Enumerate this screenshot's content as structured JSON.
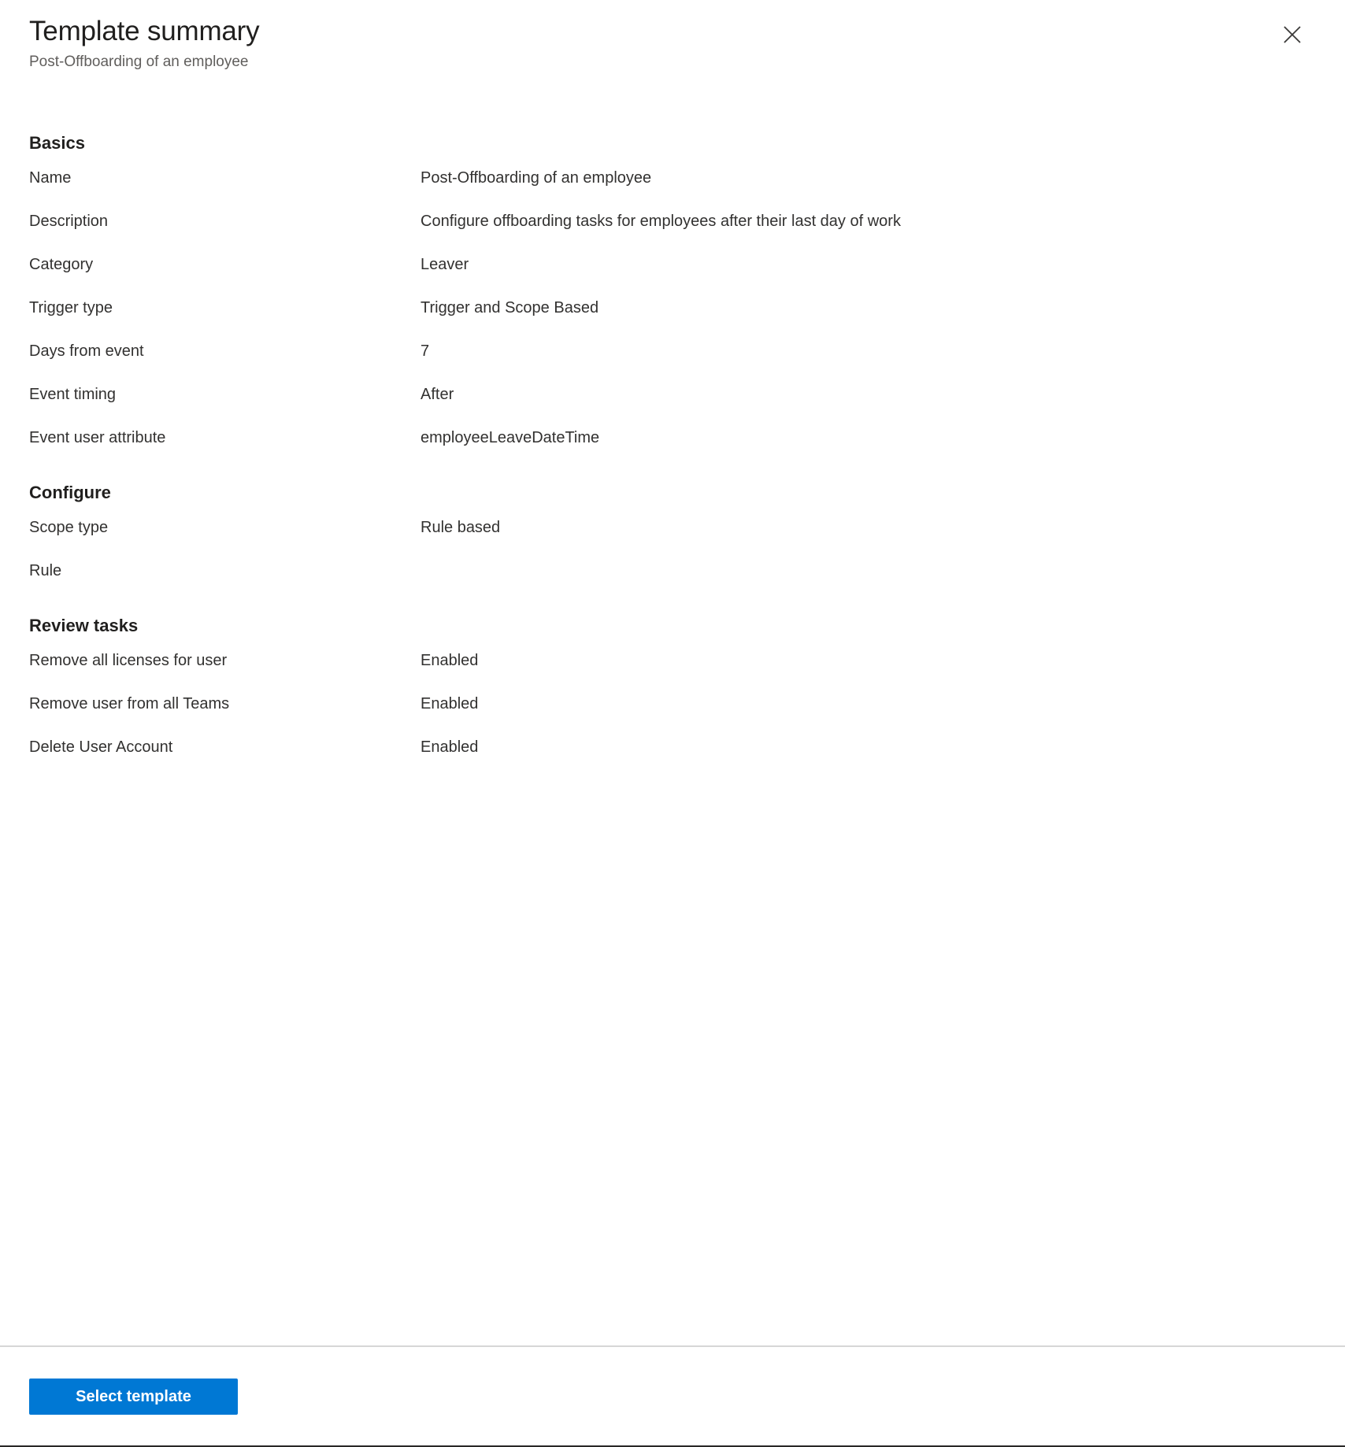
{
  "header": {
    "title": "Template summary",
    "subtitle": "Post-Offboarding of an employee",
    "close_icon": "close-icon",
    "close_label": "Close"
  },
  "sections": [
    {
      "id": "basics",
      "heading": "Basics",
      "rows": [
        {
          "label": "Name",
          "value": "Post-Offboarding of an employee"
        },
        {
          "label": "Description",
          "value": "Configure offboarding tasks for employees after their last day of work"
        },
        {
          "label": "Category",
          "value": "Leaver"
        },
        {
          "label": "Trigger type",
          "value": "Trigger and Scope Based"
        },
        {
          "label": "Days from event",
          "value": "7"
        },
        {
          "label": "Event timing",
          "value": "After"
        },
        {
          "label": "Event user attribute",
          "value": "employeeLeaveDateTime"
        }
      ]
    },
    {
      "id": "configure",
      "heading": "Configure",
      "rows": [
        {
          "label": "Scope type",
          "value": "Rule based"
        },
        {
          "label": "Rule",
          "value": ""
        }
      ]
    },
    {
      "id": "review-tasks",
      "heading": "Review tasks",
      "rows": [
        {
          "label": "Remove all licenses for user",
          "value": "Enabled"
        },
        {
          "label": "Remove user from all Teams",
          "value": "Enabled"
        },
        {
          "label": "Delete User Account",
          "value": "Enabled"
        }
      ]
    }
  ],
  "footer": {
    "select_template_label": "Select template"
  },
  "colors": {
    "accent": "#0078d4",
    "text_primary": "#323130",
    "text_heading": "#201f1e",
    "text_secondary": "#605e5c",
    "divider": "#d6d6d6",
    "page_background": "#ffffff"
  }
}
